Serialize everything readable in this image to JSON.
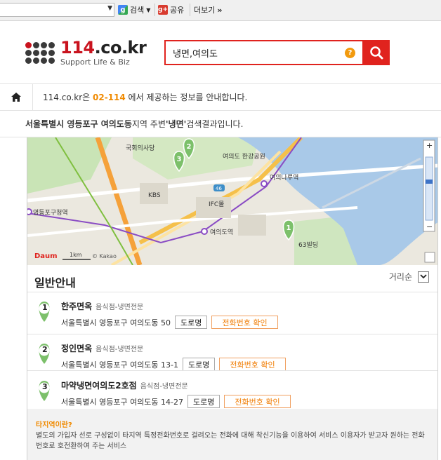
{
  "toolbar": {
    "search_label": "검색",
    "share_label": "공유",
    "more_label": "더보기"
  },
  "logo": {
    "main": "114",
    "domain": ".co.kr",
    "tagline": "Support Life & Biz"
  },
  "search": {
    "value": "냉면,여의도"
  },
  "info": {
    "prefix": "114.co.kr은 ",
    "number": "02-114",
    "suffix": " 에서 제공하는 정보를 안내합니다."
  },
  "result": {
    "location": "서울특별시 영등포구 여의도동",
    "middle": " 지역 주변 ",
    "keyword": "'냉면'",
    "suffix": " 검색결과입니다."
  },
  "map": {
    "labels": {
      "assembly": "국회의사당",
      "kbs": "KBS",
      "ifc": "IFC몰",
      "station": "여의도역",
      "office": "영등포구청역",
      "park": "여의도\n한강공원",
      "naru": "여의나루역",
      "bldg63": "63빌딩",
      "road46": "46",
      "daum": "Daum",
      "kakao": "© Kakao",
      "scale": "1km"
    },
    "pins": [
      "1",
      "2",
      "3"
    ],
    "zoom_in": "+",
    "zoom_out": "−"
  },
  "panel": {
    "title": "일반안내",
    "sort_label": "거리순"
  },
  "items": [
    {
      "num": "1",
      "name": "한주면옥",
      "category": "음식점-냉면전문",
      "address": "서울특별시 영등포구 여의도동 50",
      "road_btn": "도로명",
      "phone_btn": "전화번호 확인"
    },
    {
      "num": "2",
      "name": "정인면옥",
      "category": "음식점-냉면전문",
      "address": "서울특별시 영등포구 여의도동 13-1",
      "road_btn": "도로명",
      "phone_btn": "전화번호 확인"
    },
    {
      "num": "3",
      "name": "마약냉면여의도2호점",
      "category": "음식점-냉면전문",
      "address": "서울특별시 영등포구 여의도동 14-27",
      "road_btn": "도로명",
      "phone_btn": "전화번호 확인"
    }
  ],
  "note": {
    "title": "타지역이란?",
    "body": "별도의 가입자 선로 구성없이 타지역 특정전화번호로 걸려오는 전화에 대해 착신기능을 이용하여 서비스 이용자가 받고자 원하는 전화번호로 호전환하여 주는 서비스"
  },
  "colors": {
    "brand_red": "#e0231e",
    "accent_orange": "#f08a00",
    "pin_green": "#7cc06a"
  }
}
